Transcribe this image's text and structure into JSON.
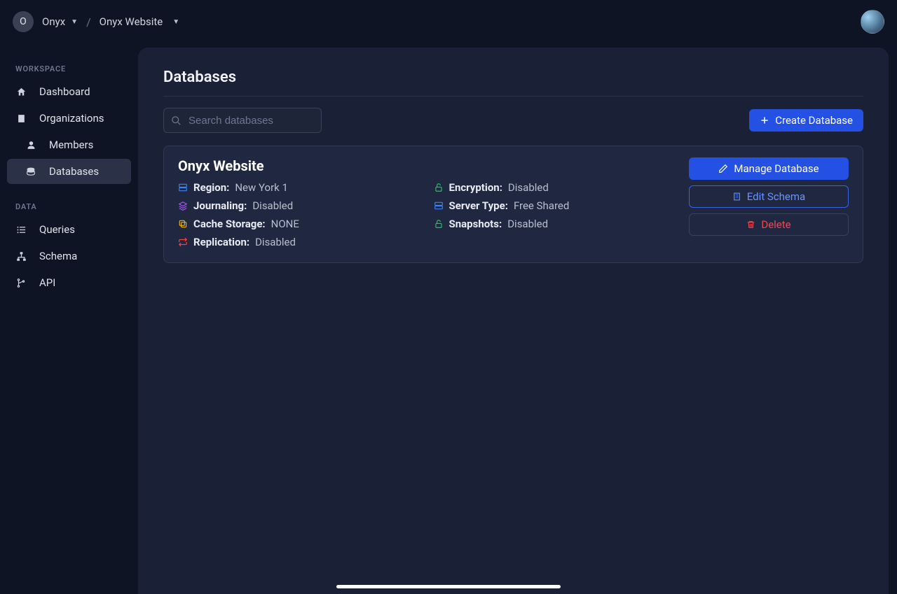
{
  "breadcrumb": {
    "org_initial": "O",
    "org_name": "Onyx",
    "project_name": "Onyx Website"
  },
  "sidebar": {
    "section1_title": "WORKSPACE",
    "section2_title": "DATA",
    "items": {
      "dashboard": "Dashboard",
      "organizations": "Organizations",
      "members": "Members",
      "databases": "Databases",
      "queries": "Queries",
      "schema": "Schema",
      "api": "API"
    }
  },
  "page": {
    "title": "Databases",
    "search_placeholder": "Search databases",
    "create_label": "Create Database"
  },
  "database": {
    "name": "Onyx Website",
    "labels": {
      "region": "Region:",
      "encryption": "Encryption:",
      "journaling": "Journaling:",
      "server_type": "Server Type:",
      "cache_storage": "Cache Storage:",
      "snapshots": "Snapshots:",
      "replication": "Replication:"
    },
    "values": {
      "region": "New York 1",
      "encryption": "Disabled",
      "journaling": "Disabled",
      "server_type": "Free Shared",
      "cache_storage": "NONE",
      "snapshots": "Disabled",
      "replication": "Disabled"
    },
    "actions": {
      "manage": "Manage Database",
      "edit_schema": "Edit Schema",
      "delete": "Delete"
    }
  }
}
